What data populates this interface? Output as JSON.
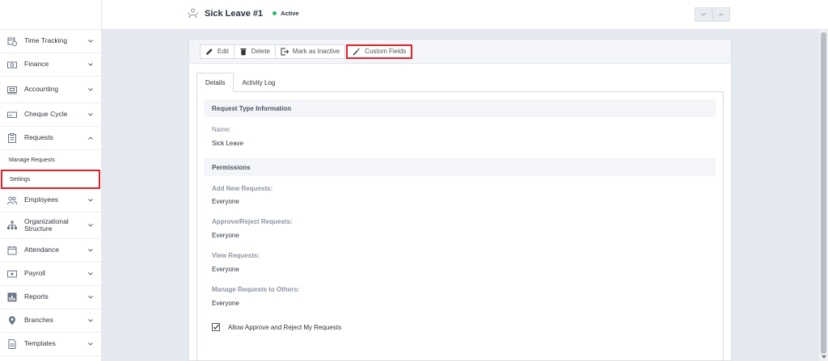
{
  "header": {
    "title": "Sick Leave #1",
    "status": "Active",
    "status_color": "#27b86a"
  },
  "sidebar": {
    "items": [
      {
        "label": "Time Tracking",
        "icon": "clock-calendar-icon",
        "expanded": false
      },
      {
        "label": "Finance",
        "icon": "money-icon",
        "expanded": false
      },
      {
        "label": "Accounting",
        "icon": "ledger-icon",
        "expanded": false
      },
      {
        "label": "Cheque Cycle",
        "icon": "cheque-icon",
        "expanded": false
      },
      {
        "label": "Requests",
        "icon": "clipboard-icon",
        "expanded": true
      },
      {
        "label": "Employees",
        "icon": "people-icon",
        "expanded": false
      },
      {
        "label": "Organizational Structure",
        "icon": "org-chart-icon",
        "expanded": false
      },
      {
        "label": "Attendance",
        "icon": "calendar-icon",
        "expanded": false
      },
      {
        "label": "Payroll",
        "icon": "payroll-icon",
        "expanded": false
      },
      {
        "label": "Reports",
        "icon": "bar-chart-icon",
        "expanded": false
      },
      {
        "label": "Branches",
        "icon": "location-pin-icon",
        "expanded": false
      },
      {
        "label": "Templates",
        "icon": "document-icon",
        "expanded": false
      }
    ],
    "sub_items": [
      {
        "label": "Manage Requests",
        "active": false
      },
      {
        "label": "Settings",
        "active": true
      }
    ]
  },
  "toolbar": {
    "edit": "Edit",
    "delete": "Delete",
    "mark_inactive": "Mark as Inactive",
    "custom_fields": "Custom Fields"
  },
  "tabs": [
    "Details",
    "Activity Log"
  ],
  "details": {
    "section1": "Request Type Information",
    "name_label": "Name:",
    "name_value": "Sick Leave",
    "section2": "Permissions",
    "add_label": "Add New Requests:",
    "add_value": "Everyone",
    "approve_label": "Approve/Reject Requests:",
    "approve_value": "Everyone",
    "view_label": "View Requests:",
    "view_value": "Everyone",
    "manage_label": "Manage Requests to Others:",
    "manage_value": "Everyone",
    "allow_label": "Allow Approve and Reject My Requests",
    "allow_checked": true
  },
  "colors": {
    "highlight": "#e0202a",
    "icon": "#6b7685"
  }
}
